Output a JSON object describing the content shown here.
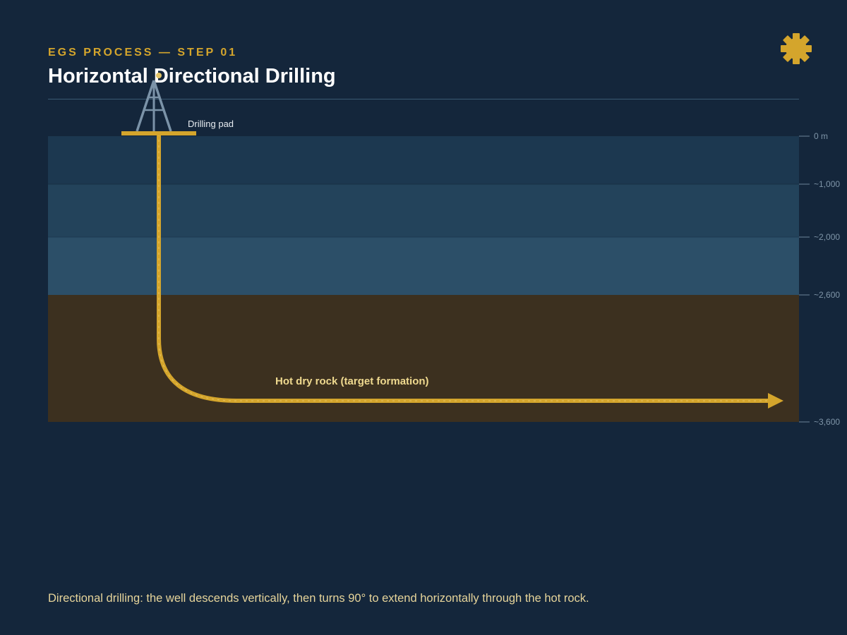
{
  "header": {
    "eyebrow": "EGS PROCESS — STEP 01",
    "title": "Horizontal Directional Drilling"
  },
  "icons": {
    "top_right": "gear-icon",
    "rig": "drilling-rig-icon"
  },
  "diagram": {
    "pad_label": "Drilling pad",
    "target_label": "Hot dry rock (target formation)",
    "depth_labels": [
      "0 m",
      "~1,000",
      "~2,000",
      "~2,600",
      "~3,600"
    ]
  },
  "caption": "Directional drilling: the well descends vertically, then turns 90° to extend horizontally through the hot rock.",
  "colors": {
    "background": "#14263b",
    "accent": "#d4a52c",
    "layer_1": "#1c3850",
    "layer_2": "#23435b",
    "layer_3": "#2c4f68",
    "hot_rock": "#3c301f",
    "rig_steel": "#7b93a8"
  }
}
